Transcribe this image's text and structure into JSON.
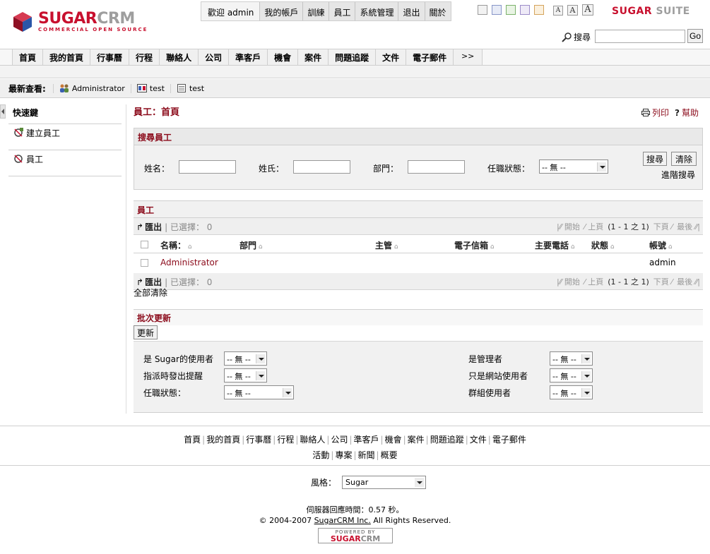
{
  "header": {
    "logo_main": "SUGAR",
    "logo_accent": "CRM",
    "logo_sub": "COMMERCIAL OPEN SOURCE",
    "suite_main": "SUGAR",
    "suite_accent": "SUITE",
    "top_links": [
      "歡迎 admin",
      "我的帳戶",
      "訓練",
      "員工",
      "系統管理",
      "退出",
      "關於"
    ],
    "font_sizes": [
      "A",
      "A",
      "A"
    ],
    "search_label": "搜尋",
    "search_value": "",
    "go_label": "Go"
  },
  "tabs": [
    "首頁",
    "我的首頁",
    "行事曆",
    "行程",
    "聯絡人",
    "公司",
    "準客戶",
    "機會",
    "案件",
    "問題追蹤",
    "文件",
    "電子郵件",
    ">>"
  ],
  "last_viewed": {
    "label": "最新查看:",
    "items": [
      {
        "label": "Administrator",
        "icon": "users-icon"
      },
      {
        "label": "test",
        "icon": "project-icon"
      },
      {
        "label": "test",
        "icon": "note-icon"
      }
    ]
  },
  "shortcuts": {
    "title": "快速鍵",
    "items": [
      "建立員工",
      "員工"
    ]
  },
  "main": {
    "page_title": "員工：首頁",
    "print_label": "列印",
    "help_label": "幫助"
  },
  "search_form": {
    "title": "搜尋員工",
    "first_name_label": "姓名：",
    "last_name_label": "姓氏：",
    "department_label": "部門：",
    "status_label": "任職狀態：",
    "status_value": "-- 無 --",
    "search_button": "搜尋",
    "clear_button": "清除",
    "advanced_link": "進階搜尋"
  },
  "list": {
    "title": "員工",
    "export_label": "匯出",
    "selected_label": "已選擇：",
    "selected_count": "0",
    "pager": {
      "start": "開始",
      "prev": "上頁",
      "count": "(1 - 1 之 1)",
      "next": "下頁",
      "end": "最後"
    },
    "columns": [
      "名稱：",
      "部門",
      "主管",
      "電子信箱",
      "主要電話",
      "狀態",
      "帳號"
    ],
    "rows": [
      {
        "name": "Administrator",
        "department": "",
        "manager": "",
        "email": "",
        "phone": "",
        "status": "",
        "username": "admin"
      }
    ],
    "clear_all": "全部清除"
  },
  "mass_update": {
    "title": "批次更新",
    "update_button": "更新",
    "fields_left": [
      {
        "label": "是 Sugar的使用者",
        "value": "-- 無 --"
      },
      {
        "label": "指派時發出提醒",
        "value": "-- 無 --"
      },
      {
        "label": "任職狀態：",
        "value": "-- 無 --"
      }
    ],
    "fields_right": [
      {
        "label": "是管理者",
        "value": "-- 無 --"
      },
      {
        "label": "只是網站使用者",
        "value": "-- 無 --"
      },
      {
        "label": "群組使用者",
        "value": "-- 無 --"
      }
    ]
  },
  "footer": {
    "links_row1": [
      "首頁",
      "我的首頁",
      "行事曆",
      "行程",
      "聯絡人",
      "公司",
      "準客戶",
      "機會",
      "案件",
      "問題追蹤",
      "文件",
      "電子郵件"
    ],
    "links_row2": [
      "活動",
      "專案",
      "新聞",
      "概要"
    ],
    "theme_label": "風格：",
    "theme_value": "Sugar",
    "response_time": "伺服器回應時間：0.57 秒。",
    "copyright_prefix": "© 2004-2007",
    "copyright_company": "SugarCRM Inc.",
    "copyright_suffix": "All Rights Reserved.",
    "powered_by": "POWERED BY",
    "powered_main": "SUGAR",
    "powered_accent": "CRM"
  },
  "colors": {
    "brand_red": "#c8102e",
    "link": "#8b0a1a"
  }
}
